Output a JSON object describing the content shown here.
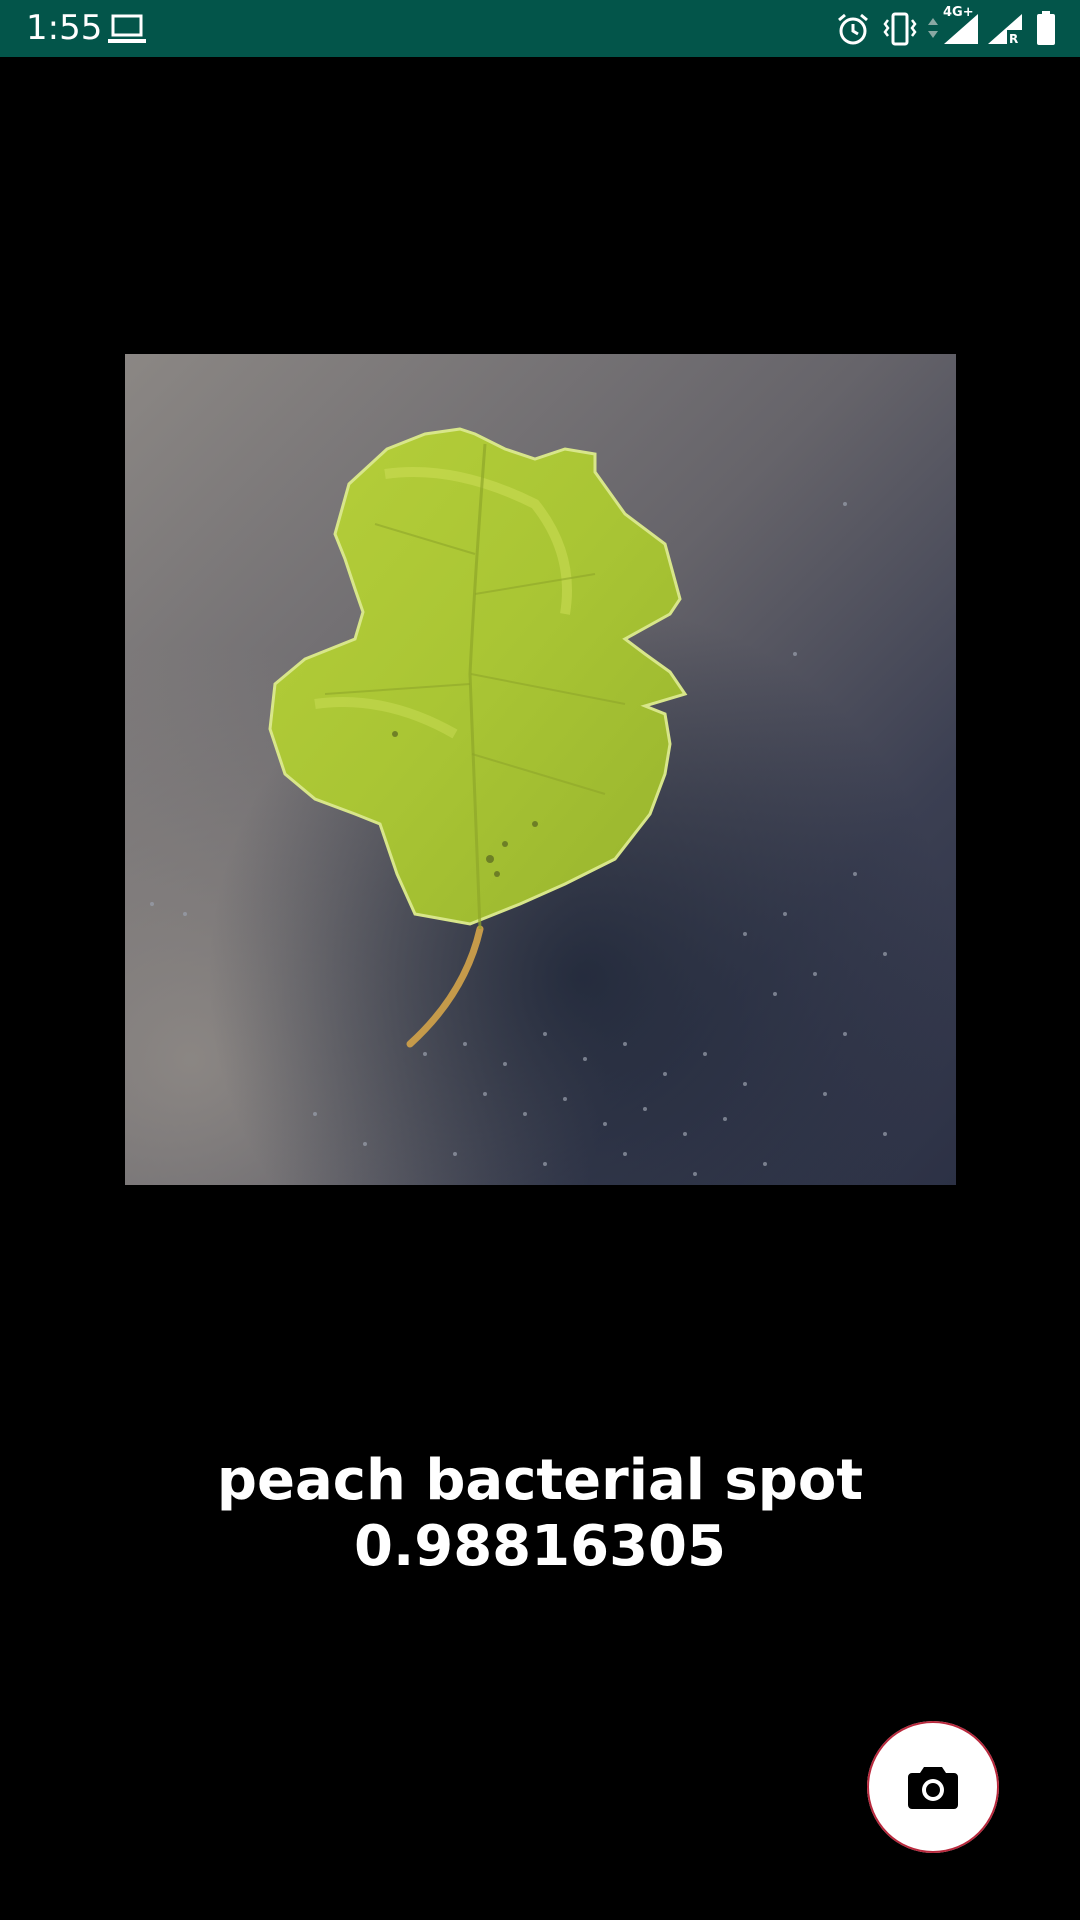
{
  "status_bar": {
    "time": "1:55",
    "network_type": "4G+",
    "roaming_indicator": "R",
    "icons": [
      "laptop-icon",
      "alarm-icon",
      "vibrate-icon",
      "data-arrows-icon",
      "signal-icon",
      "signal-roaming-icon",
      "battery-icon"
    ],
    "background_color": "#03554a"
  },
  "photo": {
    "subject": "leaf-photo"
  },
  "result": {
    "label": "peach bacterial spot",
    "confidence": "0.98816305"
  },
  "camera_button": {
    "icon": "camera-icon",
    "accent_color": "#b8293d"
  }
}
